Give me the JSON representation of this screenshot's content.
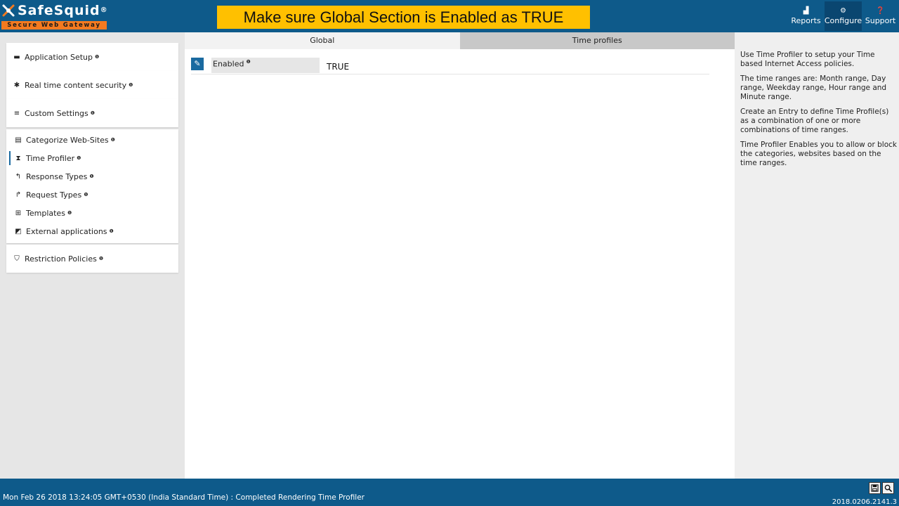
{
  "brand": {
    "name": "SafeSquid",
    "reg": "®",
    "tagline": "Secure Web Gateway",
    "accent": "#f47a20",
    "header_color": "#0e5a8a"
  },
  "banner": {
    "text": "Make sure Global Section is Enabled as TRUE",
    "color": "#ffc000"
  },
  "topnav": [
    {
      "label": "Reports",
      "icon": "bar-chart-icon",
      "glyph": "▟"
    },
    {
      "label": "Configure",
      "icon": "cogs-icon",
      "glyph": "⚙"
    },
    {
      "label": "Support",
      "icon": "question-icon",
      "glyph": "❓"
    }
  ],
  "sidebar": {
    "info_glyph": "❶",
    "sections": [
      {
        "label": "Application Setup",
        "icon": "briefcase-icon",
        "glyph": "▬"
      },
      {
        "label": "Real time content security",
        "icon": "bug-icon",
        "glyph": "✱"
      },
      {
        "label": "Custom Settings",
        "icon": "sliders-icon",
        "glyph": "≡"
      },
      {
        "label": "Restriction Policies",
        "icon": "shield-icon",
        "glyph": "⛉"
      }
    ],
    "custom_items": [
      {
        "label": "Categorize Web-Sites",
        "icon": "database-icon",
        "glyph": "▤"
      },
      {
        "label": "Time Profiler",
        "icon": "hourglass-icon",
        "glyph": "⧗"
      },
      {
        "label": "Response Types",
        "icon": "reply-icon",
        "glyph": "↰"
      },
      {
        "label": "Request Types",
        "icon": "share-icon",
        "glyph": "↱"
      },
      {
        "label": "Templates",
        "icon": "sitemap-icon",
        "glyph": "⊞"
      },
      {
        "label": "External applications",
        "icon": "external-app-icon",
        "glyph": "◩"
      }
    ]
  },
  "main": {
    "tabs": [
      {
        "label": "Global"
      },
      {
        "label": "Time profiles"
      }
    ],
    "field": {
      "label": "Enabled",
      "value": "TRUE"
    },
    "edit_glyph": "✎"
  },
  "help": {
    "paragraphs": [
      "Use Time Profiler to setup your Time based Internet Access policies.",
      "The time ranges are: Month range, Day range, Weekday range, Hour range and Minute range.",
      "Create an Entry to define Time Profile(s) as a combination of one or more combinations of time ranges.",
      "Time Profiler Enables you to allow or block the categories, websites based on the time ranges."
    ]
  },
  "footer": {
    "status": "Mon Feb 26 2018 13:24:05 GMT+0530 (India Standard Time) : Completed Rendering Time Profiler",
    "version": "2018.0206.2141.3",
    "save_glyph": "💾",
    "search_glyph": "🔍"
  }
}
